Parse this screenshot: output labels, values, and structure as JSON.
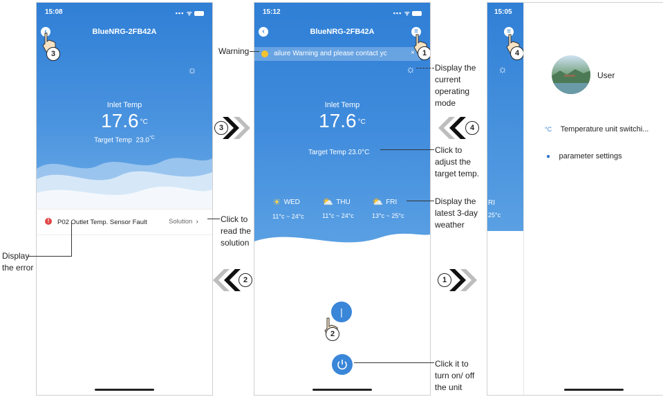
{
  "screen1": {
    "time": "15:08",
    "device_title": "BlueNRG-2FB42A",
    "inlet_label": "Inlet Temp",
    "inlet_value": "17.6",
    "unit": "°C",
    "target_label": "Target Temp",
    "target_value": "23.0",
    "error_text": "P02 Outlet Temp. Sensor Fault",
    "solution_label": "Solution",
    "hand_number": "3"
  },
  "screen2": {
    "time": "15:12",
    "device_title": "BlueNRG-2FB42A",
    "warning_text": "ailure Warning and please contact yc",
    "inlet_label": "Inlet Temp",
    "inlet_value": "17.6",
    "unit": "°C",
    "target_text": "Target Temp  23.0°C",
    "weather": [
      {
        "day": "WED",
        "range": "11°c ~ 24°c",
        "icon": "sun-icon"
      },
      {
        "day": "THU",
        "range": "11°c ~ 24°c",
        "icon": "partly-cloudy-icon"
      },
      {
        "day": "FRI",
        "range": "13°c ~ 25°c",
        "icon": "partly-cloudy-icon"
      }
    ],
    "menu_hand_number": "1",
    "power_hand_number": "2"
  },
  "screen3": {
    "time": "15:05",
    "menu_hand_number": "4",
    "partial_day": "RI",
    "partial_temp": "25°c",
    "user_label": "User",
    "menu_items": [
      {
        "icon": "°C",
        "label": "Temperature unit switchi..."
      },
      {
        "icon": "gear",
        "label": "parameter settings"
      }
    ]
  },
  "annotations": {
    "warning": "Warning",
    "display_mode": [
      "Display the",
      "current",
      "operating",
      "mode"
    ],
    "adjust_target": [
      "Click to",
      "adjust the",
      "target temp."
    ],
    "weather_info": [
      "Display the",
      "latest 3-day",
      "weather"
    ],
    "read_solution": [
      "Click to",
      "read the",
      "solution"
    ],
    "display_error": [
      "Display",
      "the error"
    ],
    "power_info": [
      "Click it to",
      "turn on/ off",
      "the unit"
    ],
    "arrow_3": "3",
    "arrow_4": "4",
    "arrow_2": "2",
    "arrow_1": "1"
  },
  "colors": {
    "app_blue": "#3a86d8",
    "dark_blue": "#2c74c9",
    "error_red": "#e04646",
    "warning_yellow": "#f2c230"
  }
}
